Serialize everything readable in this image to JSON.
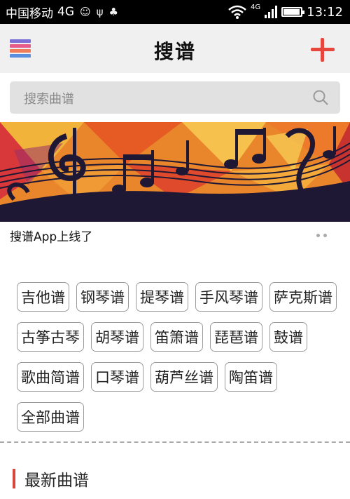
{
  "status_bar": {
    "carrier": "中国移动",
    "network": "4G",
    "network_small": "4G",
    "time": "13:12",
    "battery_level": 0.95,
    "icons": [
      "smile-icon",
      "usb-icon",
      "android-icon",
      "wifi-icon",
      "signal-icon",
      "battery-charging-icon"
    ]
  },
  "header": {
    "title": "搜谱",
    "menu_icon": "menu-grid-icon",
    "add_icon": "plus-icon",
    "menu_colors": [
      "#7b6fd6",
      "#e65b8a",
      "#f07d5a",
      "#5a8fe0"
    ],
    "accent": "#e7463c"
  },
  "search": {
    "placeholder": "搜索曲谱",
    "icon": "search-icon"
  },
  "banner": {
    "caption": "搜谱App上线了",
    "page_indicator_count": 2
  },
  "categories": {
    "rows": [
      [
        "吉他谱",
        "钢琴谱",
        "提琴谱",
        "手风琴谱",
        "萨克斯谱"
      ],
      [
        "古筝古琴",
        "胡琴谱",
        "笛箫谱",
        "琵琶谱",
        "鼓谱"
      ],
      [
        "歌曲简谱",
        "口琴谱",
        "葫芦丝谱",
        "陶笛谱"
      ],
      [
        "全部曲谱"
      ]
    ]
  },
  "latest": {
    "title": "最新曲谱",
    "accent": "#d9473c"
  }
}
